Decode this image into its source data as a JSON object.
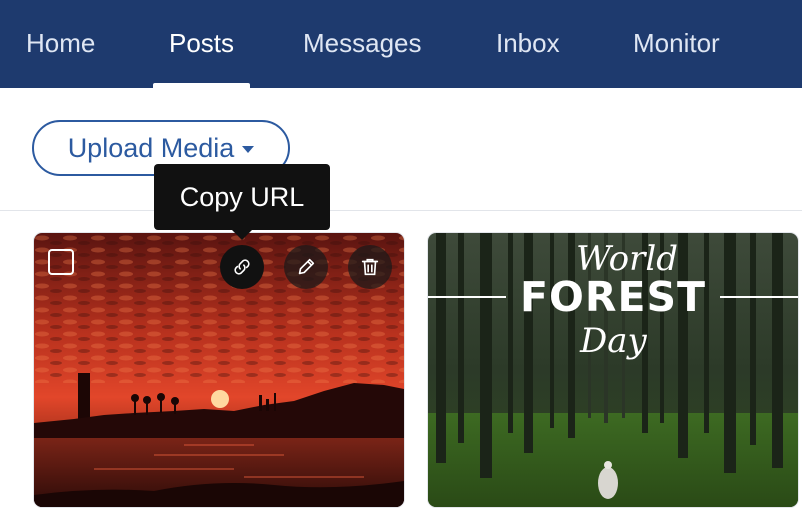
{
  "nav": {
    "items": [
      {
        "label": "Home"
      },
      {
        "label": "Posts",
        "active": true
      },
      {
        "label": "Messages"
      },
      {
        "label": "Inbox"
      },
      {
        "label": "Monitor"
      }
    ],
    "colors": {
      "background": "#1e3a6e",
      "active": "#ffffff"
    }
  },
  "toolbar": {
    "upload_label": "Upload Media",
    "upload_icon": "caret-down-icon",
    "accent_color": "#2c5aa0"
  },
  "tooltip": {
    "text": "Copy URL"
  },
  "media": [
    {
      "image": "sunset over sea with city silhouette",
      "actions": [
        "link-icon",
        "pencil-icon",
        "trash-icon"
      ],
      "active_action": "link-icon",
      "checked": false
    },
    {
      "image": "forest poster",
      "poster": {
        "line1": "World",
        "line2": "FOREST",
        "line3": "Day"
      }
    }
  ]
}
